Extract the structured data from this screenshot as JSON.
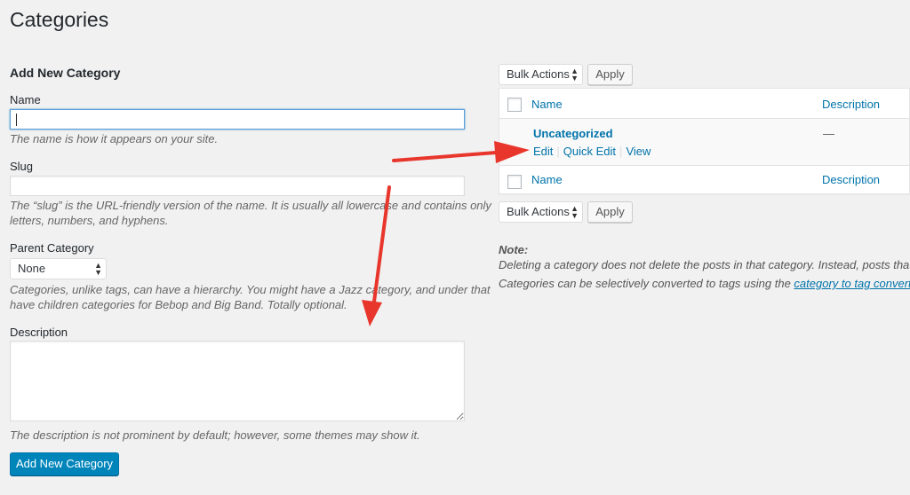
{
  "page_title": "Categories",
  "form": {
    "heading": "Add New Category",
    "name_label": "Name",
    "name_value": "",
    "name_help": "The name is how it appears on your site.",
    "slug_label": "Slug",
    "slug_value": "",
    "slug_help_line1": "The “slug” is the URL-friendly version of the name. It is usually all lowercase and contains only",
    "slug_help_line2": "letters, numbers, and hyphens.",
    "parent_label": "Parent Category",
    "parent_selected": "None",
    "parent_help_line1": "Categories, unlike tags, can have a hierarchy. You might have a Jazz category, and under that",
    "parent_help_line2": "have children categories for Bebop and Big Band. Totally optional.",
    "description_label": "Description",
    "description_value": "",
    "description_help": "The description is not prominent by default; however, some themes may show it.",
    "submit_label": "Add New Category"
  },
  "list": {
    "bulk_top": {
      "selected": "Bulk Actions",
      "apply_label": "Apply"
    },
    "bulk_bottom": {
      "selected": "Bulk Actions",
      "apply_label": "Apply"
    },
    "columns": {
      "name": "Name",
      "description": "Description"
    },
    "rows": [
      {
        "name": "Uncategorized",
        "description": "—",
        "actions": {
          "edit": "Edit",
          "quick_edit": "Quick Edit",
          "view": "View"
        }
      }
    ],
    "note": {
      "title": "Note:",
      "line1": "Deleting a category does not delete the posts in that category. Instead, posts that were only assigned to the deleted category are set to the category Uncategorized.",
      "line2_prefix": "Categories can be selectively converted to tags using the ",
      "line2_link": "category to tag converter",
      "line2_suffix": "."
    }
  },
  "colors": {
    "background": "#f1f1f1",
    "link": "#0073aa",
    "primary_button": "#0085ba",
    "annotation_arrow": "#e8362c"
  },
  "icons": {
    "select_arrows": "⬍"
  }
}
